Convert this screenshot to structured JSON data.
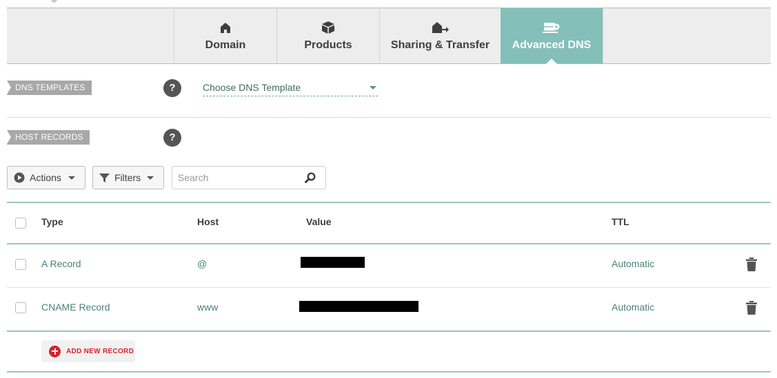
{
  "tabs": [
    {
      "label": "Domain",
      "icon": "home-icon",
      "active": false
    },
    {
      "label": "Products",
      "icon": "box-icon",
      "active": false
    },
    {
      "label": "Sharing & Transfer",
      "icon": "house-arrow-icon",
      "active": false
    },
    {
      "label": "Advanced DNS",
      "icon": "server-gear-icon",
      "active": true
    }
  ],
  "dns_templates": {
    "section_label": "DNS TEMPLATES",
    "help": "?",
    "select_value": "Choose DNS Template"
  },
  "host_records": {
    "section_label": "HOST RECORDS",
    "help": "?"
  },
  "toolbar": {
    "actions_label": "Actions",
    "filters_label": "Filters",
    "search_placeholder": "Search"
  },
  "table": {
    "columns": {
      "type": "Type",
      "host": "Host",
      "value": "Value",
      "ttl": "TTL"
    },
    "rows": [
      {
        "type": "A Record",
        "host": "@",
        "value": "",
        "ttl": "Automatic"
      },
      {
        "type": "CNAME Record",
        "host": "www",
        "value": "",
        "ttl": "Automatic"
      }
    ]
  },
  "add_record_label": "ADD NEW RECORD",
  "colors": {
    "accent": "#84bfb9",
    "teal_text": "#4a7f7a",
    "danger": "#d8232a"
  }
}
